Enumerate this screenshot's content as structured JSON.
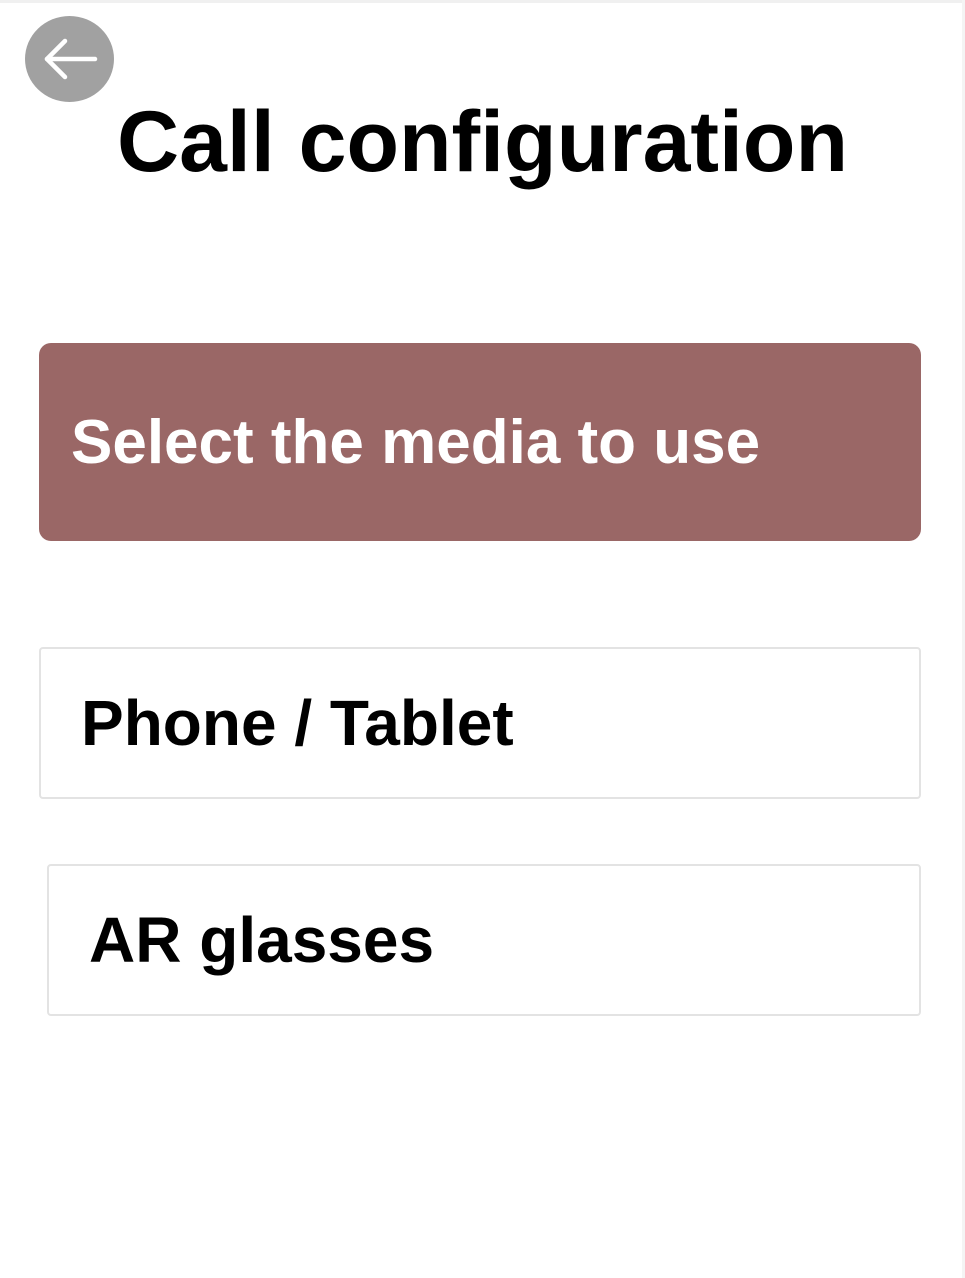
{
  "header": {
    "title": "Call configuration",
    "back_icon": "arrow-left-icon"
  },
  "prompt": {
    "text": "Select the media to use",
    "color": "#9a6766"
  },
  "options": [
    {
      "label": "Phone / Tablet"
    },
    {
      "label": "AR glasses"
    }
  ]
}
